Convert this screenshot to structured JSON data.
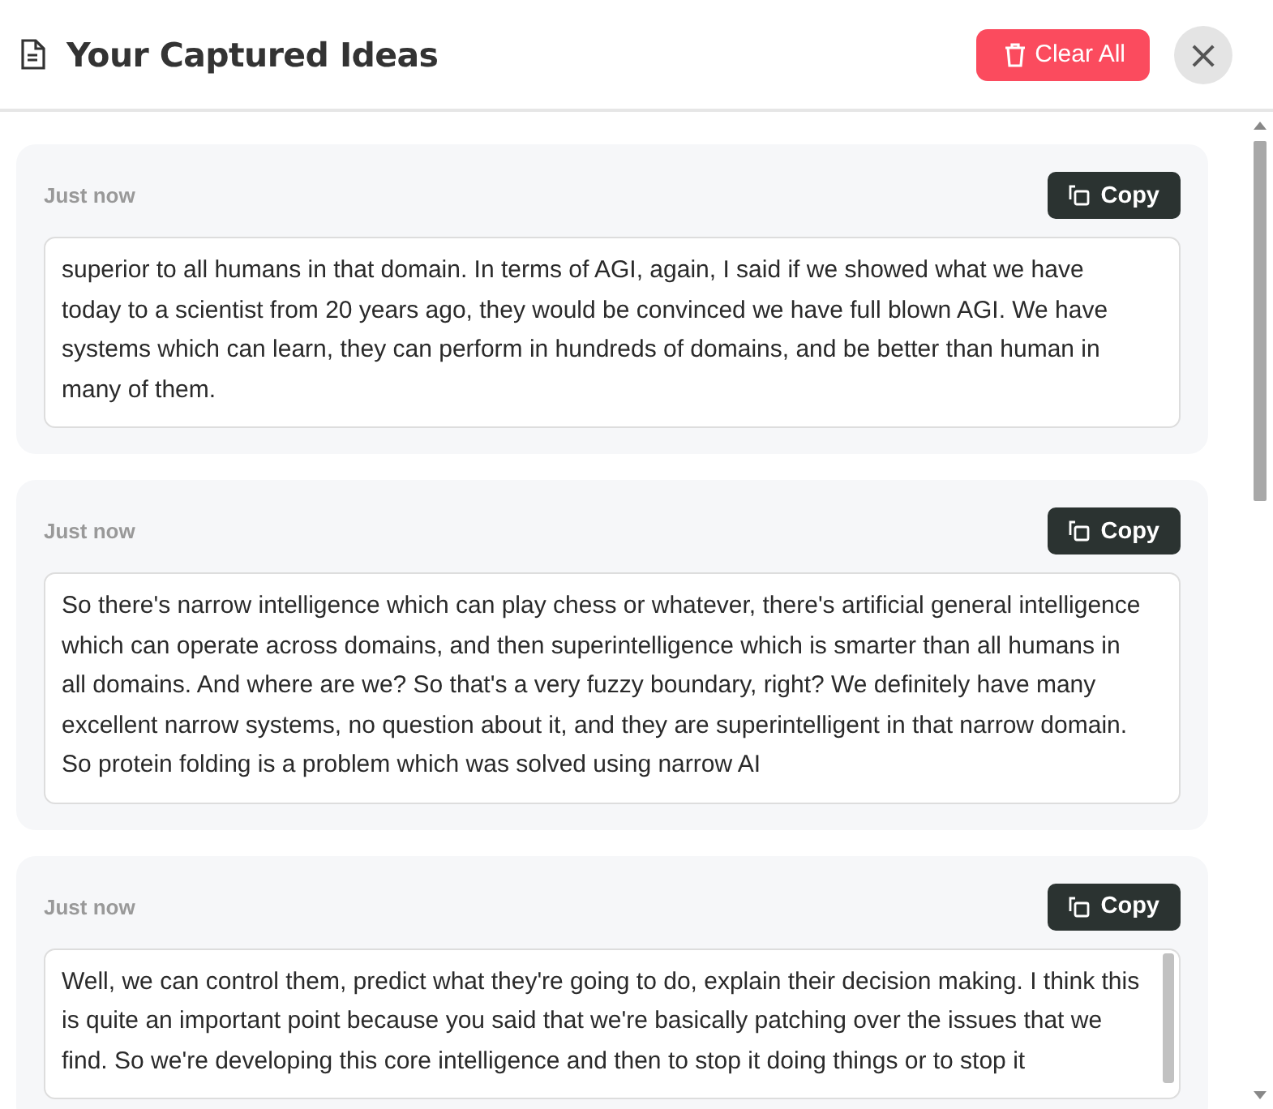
{
  "header": {
    "title": "Your Captured Ideas",
    "clear_button": "Clear All",
    "close_button": "×"
  },
  "ideas": [
    {
      "time": "Just now",
      "copy_button": "Copy",
      "text": "superior to all humans in that domain. In terms of AGI, again, I said if we showed what we have today to a scientist from 20 years ago, they would be convinced we have full blown AGI. We have systems which can learn, they can perform in hundreds of domains, and be better than human in many of them.",
      "scrollable": false
    },
    {
      "time": "Just now",
      "copy_button": "Copy",
      "text": "So there's narrow intelligence which can play chess or whatever, there's artificial general intelligence which can operate across domains, and then superintelligence which is smarter than all humans in all domains. And where are we? So that's a very fuzzy boundary, right? We definitely have many excellent narrow systems, no question about it, and they are superintelligent in that narrow domain. So protein folding is a problem which was solved using narrow AI",
      "scrollable": false
    },
    {
      "time": "Just now",
      "copy_button": "Copy",
      "text": "Well, we can control them, predict what they're going to do, explain their decision making. I think this is quite an important point because you said that we're basically patching over the issues that we find. So we're developing this core intelligence and then to stop it doing things or to stop it",
      "scrollable": true
    }
  ]
}
